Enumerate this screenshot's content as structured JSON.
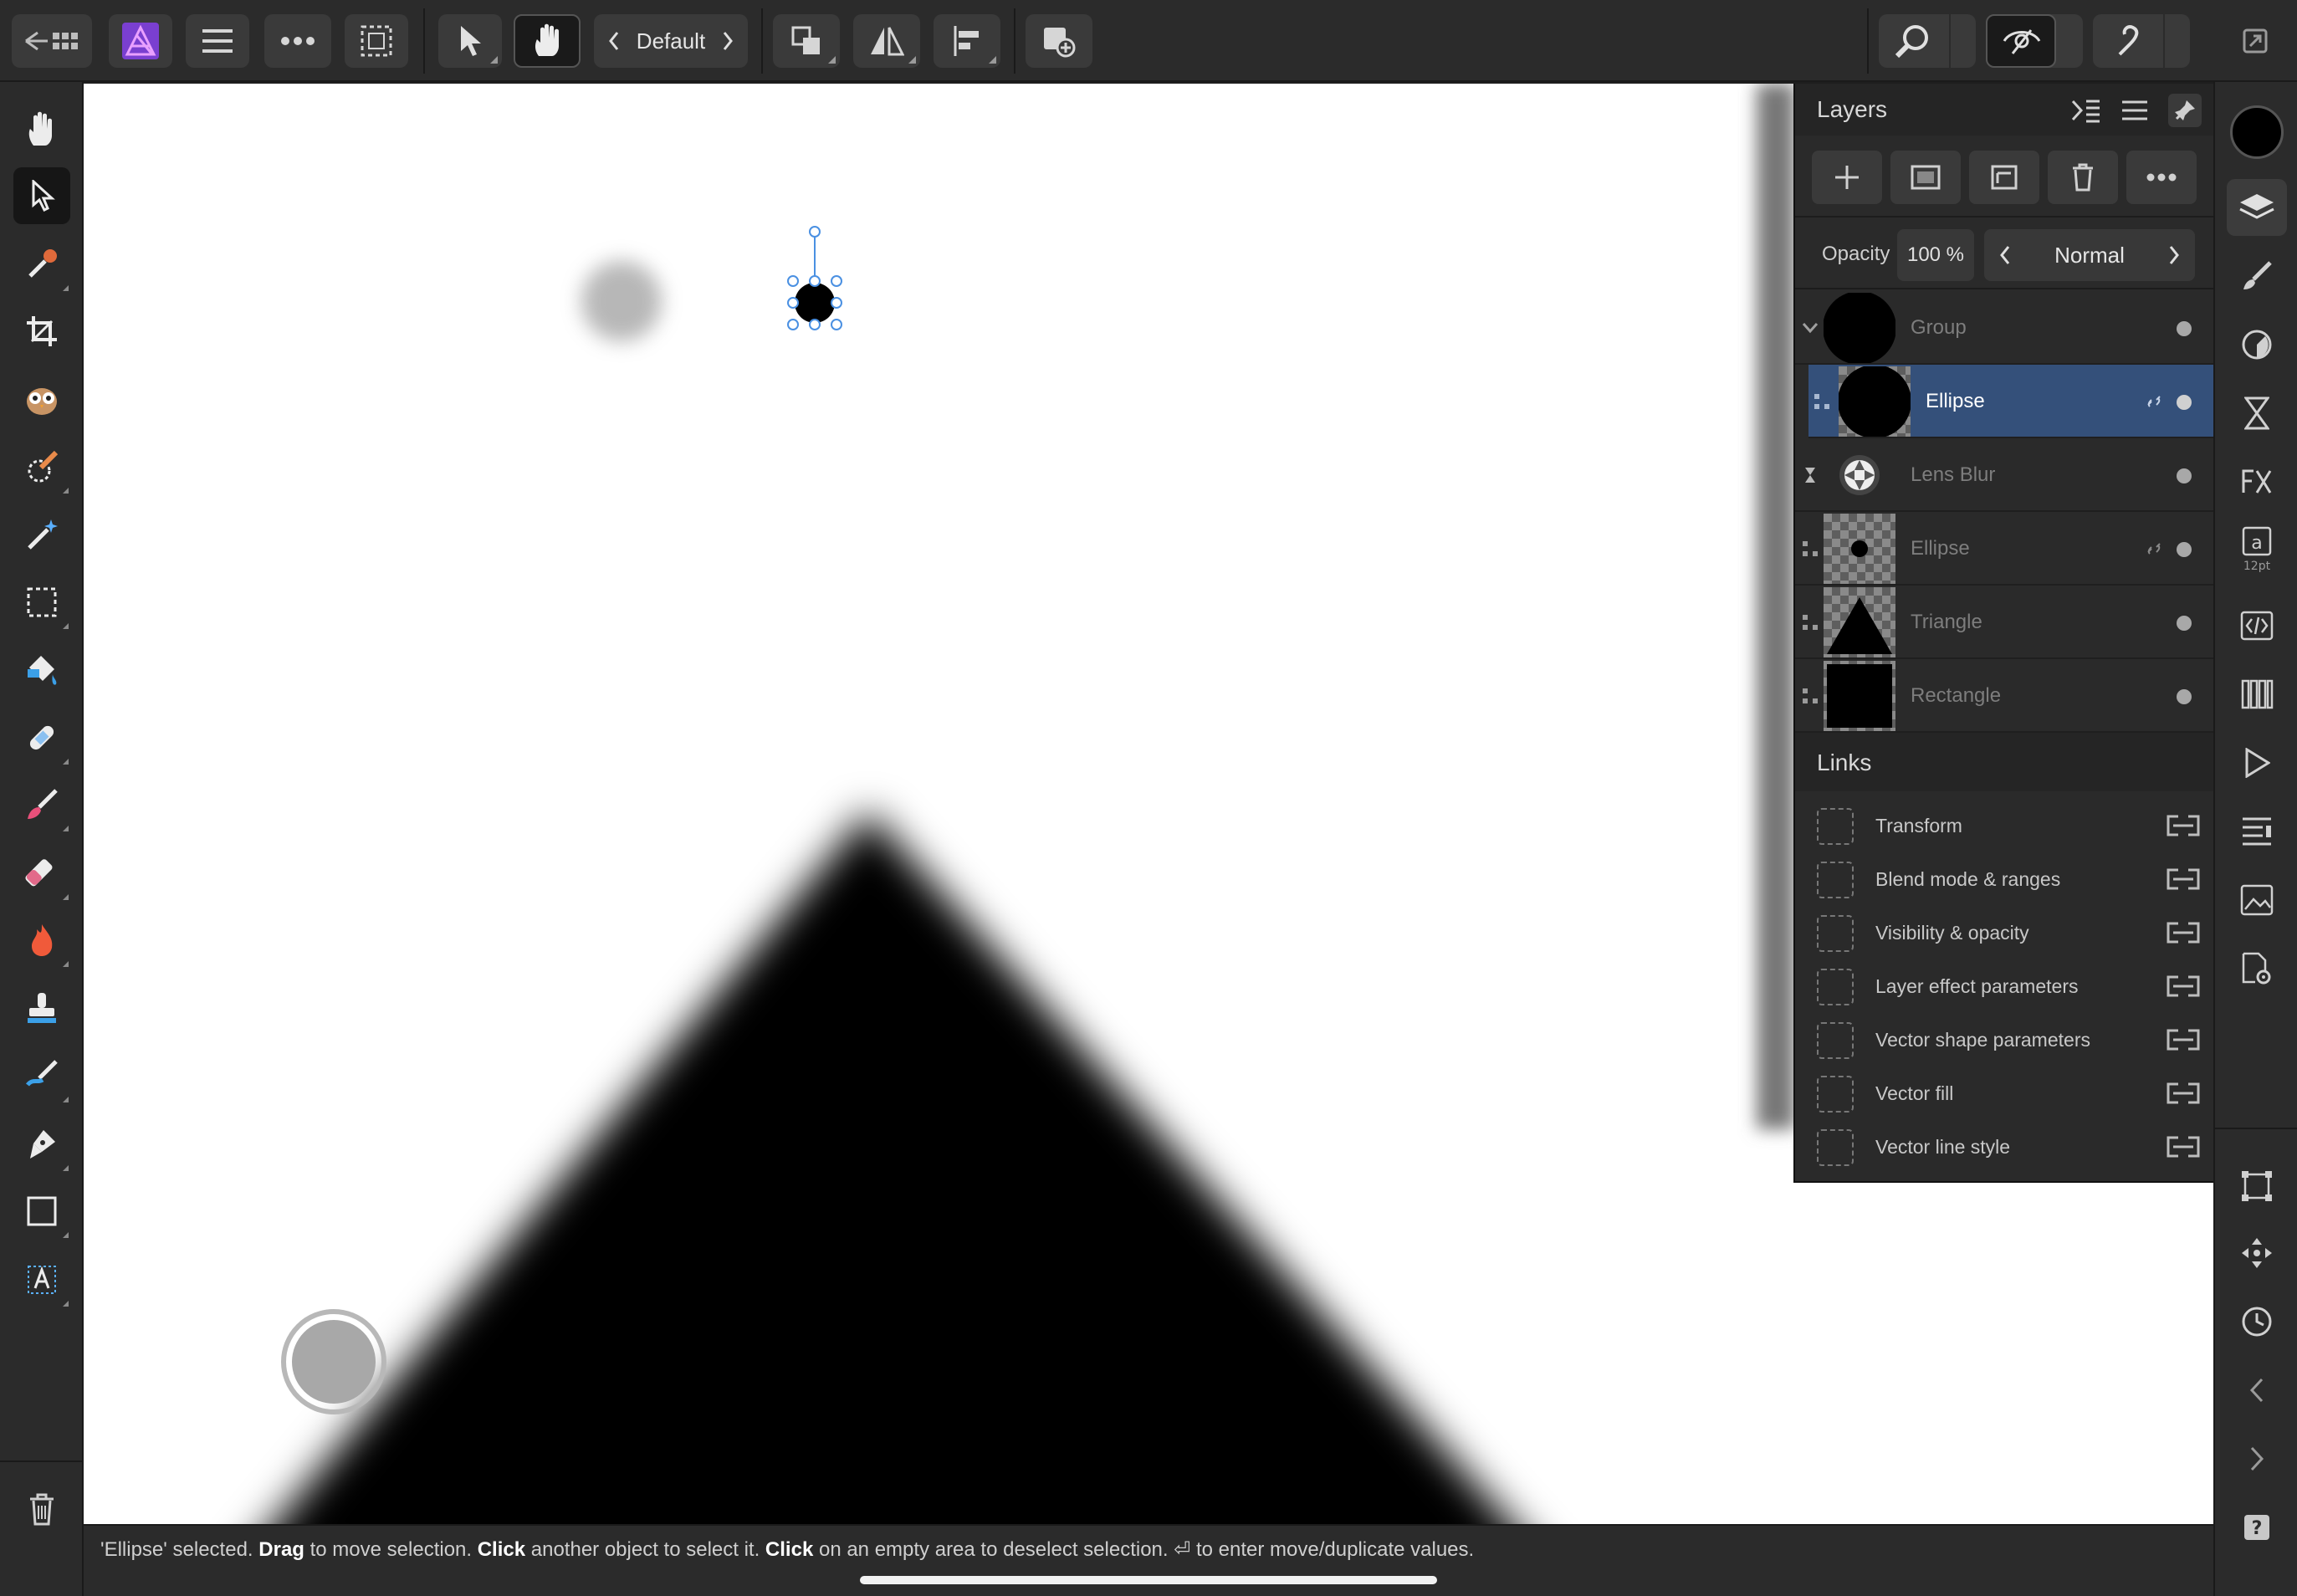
{
  "app": {
    "persona_label": "Default",
    "accent_color": "#34507a",
    "primary_color": "#000000"
  },
  "toolbar": {
    "items": [
      "back-to-documents-icon",
      "affinity-photo-logo",
      "menu-icon",
      "more-icon",
      "selection-mode-icon",
      "move-tool-icon",
      "touch-gesture-icon",
      "persona-switcher",
      "arrange-icon",
      "flip-icon",
      "align-icon",
      "insert-icon",
      "zoom-icon",
      "view-mode-icon",
      "assist-icon",
      "fullscreen-icon"
    ]
  },
  "left_tools": [
    "view-tool",
    "move-tool",
    "color-picker-tool",
    "crop-tool",
    "owl-tool",
    "selection-brush-tool",
    "magic-wand-tool",
    "rectangular-marquee-tool",
    "flood-fill-tool",
    "healing-tool",
    "paint-brush-tool",
    "erase-tool",
    "burn-tool",
    "clone-tool",
    "smudge-tool",
    "pen-tool",
    "rectangle-tool",
    "text-tool",
    "delete-tool"
  ],
  "right_strip": {
    "text_size_badge": "12pt"
  },
  "layers_panel": {
    "title": "Layers",
    "opacity_label": "Opacity",
    "opacity_value": "100 %",
    "blend_mode": "Normal",
    "layers": [
      {
        "name": "Group",
        "selected": false
      },
      {
        "name": "Ellipse",
        "selected": true
      },
      {
        "name": "Lens Blur",
        "selected": false
      },
      {
        "name": "Ellipse",
        "selected": false
      },
      {
        "name": "Triangle",
        "selected": false
      },
      {
        "name": "Rectangle",
        "selected": false
      }
    ]
  },
  "links_panel": {
    "title": "Links",
    "items": [
      "Transform",
      "Blend mode & ranges",
      "Visibility & opacity",
      "Layer effect parameters",
      "Vector shape parameters",
      "Vector fill",
      "Vector line style"
    ]
  },
  "status": {
    "part1": "'Ellipse' selected. ",
    "bold1": "Drag",
    "part2": " to move selection. ",
    "bold2": "Click",
    "part3": " another object to select it. ",
    "bold3": "Click",
    "part4": " on an empty area to deselect selection. ",
    "return_glyph": "⏎",
    "part5": " to enter move/duplicate values."
  }
}
